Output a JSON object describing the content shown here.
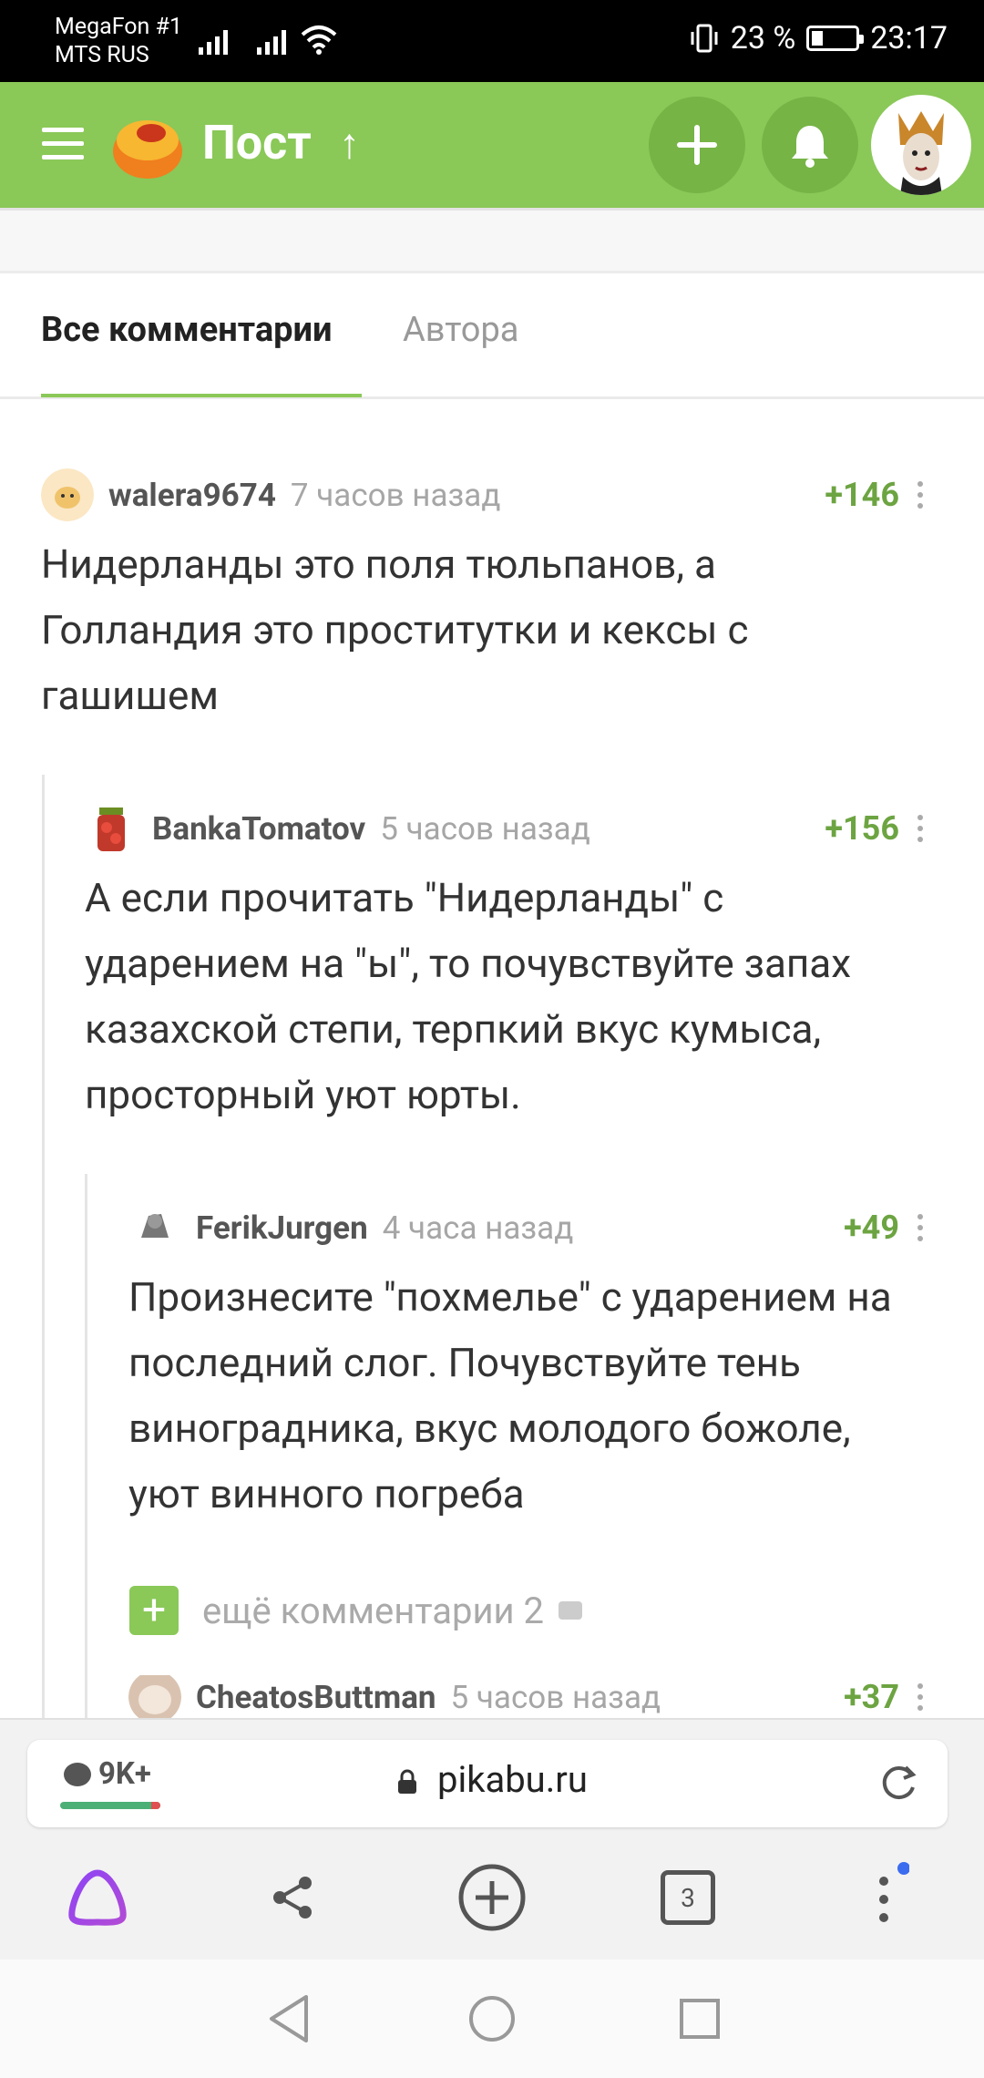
{
  "status_bar": {
    "carrier1": "MegaFon #1",
    "carrier2": "MTS RUS",
    "battery": "23 %",
    "time": "23:17"
  },
  "header": {
    "title": "Пост",
    "menu_icon": "hamburger-icon",
    "add_icon": "plus-icon",
    "notif_icon": "bell-icon",
    "colors": {
      "brand": "#8ac858",
      "brand_dark": "#76b446"
    }
  },
  "tabs": {
    "all_label": "Все комментарии",
    "author_label": "Автора"
  },
  "comments": [
    {
      "user": "walera9674",
      "time": "7 часов назад",
      "rating": "+146",
      "text": "Нидерланды это поля тюльпанов, а Голландия это проститутки и кексы с гашишем"
    },
    {
      "user": "BankaTomatov",
      "time": "5 часов назад",
      "rating": "+156",
      "text": "А если прочитать \"Нидерланды\" с ударением на \"ы\", то почувствуйте запах казахской степи, терпкий вкус кумыса, просторный уют юрты."
    },
    {
      "user": "FerikJurgen",
      "time": "4 часа назад",
      "rating": "+49",
      "text": "Произнесите \"похмелье\" с ударением на последний слог. Почувствуйте тень виноградника, вкус молодого божоле, уют винного погреба"
    },
    {
      "user": "CheatosButtman",
      "time": "5 часов назад",
      "rating": "+37",
      "text": ""
    }
  ],
  "more_comments": {
    "label": "ещё комментарии 2"
  },
  "browser": {
    "comments_count": "9K+",
    "url": "pikabu.ru",
    "tabs_count": "3"
  }
}
